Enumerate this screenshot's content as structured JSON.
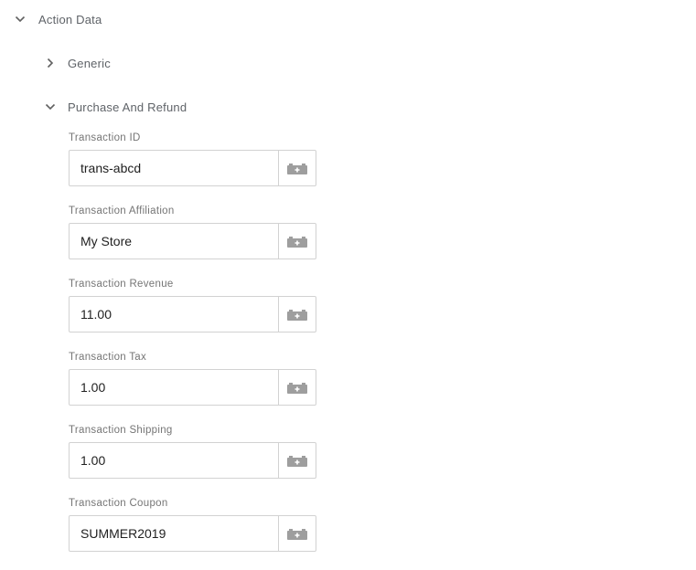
{
  "sections": {
    "action_data": {
      "title": "Action Data",
      "expanded": true
    },
    "generic": {
      "title": "Generic",
      "expanded": false
    },
    "purchase_and_refund": {
      "title": "Purchase And Refund",
      "expanded": true
    }
  },
  "fields": [
    {
      "label": "Transaction ID",
      "value": "trans-abcd"
    },
    {
      "label": "Transaction Affiliation",
      "value": "My Store"
    },
    {
      "label": "Transaction Revenue",
      "value": "11.00"
    },
    {
      "label": "Transaction Tax",
      "value": "1.00"
    },
    {
      "label": "Transaction Shipping",
      "value": "1.00"
    },
    {
      "label": "Transaction Coupon",
      "value": "SUMMER2019"
    }
  ],
  "icons": {
    "expanded": "chevron-down-icon",
    "collapsed": "chevron-right-icon",
    "variable": "add-variable-icon"
  },
  "colors": {
    "text": "#5f6368",
    "label": "#757575",
    "value": "#212121",
    "border": "#d2d2d2",
    "icon": "#9e9e9e"
  }
}
